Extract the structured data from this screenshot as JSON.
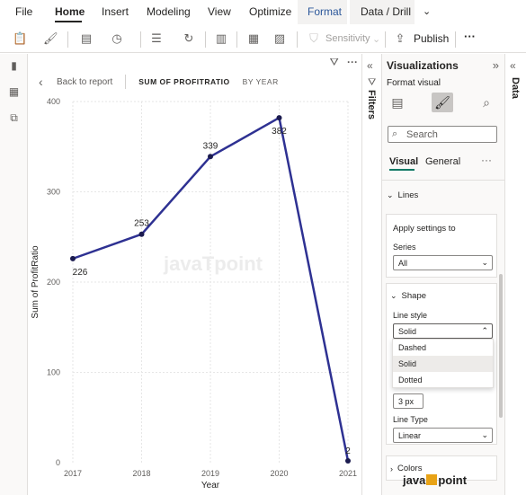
{
  "ribbon": {
    "tabs": [
      {
        "label": "File"
      },
      {
        "label": "Home"
      },
      {
        "label": "Insert"
      },
      {
        "label": "Modeling"
      },
      {
        "label": "View"
      },
      {
        "label": "Optimize"
      },
      {
        "label": "Format"
      },
      {
        "label": "Data / Drill"
      }
    ],
    "active_tab": "Home",
    "expand_icon": "chevron-down-icon"
  },
  "toolbar": {
    "sensitivity_label": "Sensitivity",
    "publish_label": "Publish",
    "more_label": "···"
  },
  "leftrail": {
    "items": [
      {
        "icon": "report-view-icon"
      },
      {
        "icon": "table-view-icon"
      },
      {
        "icon": "model-view-icon"
      }
    ]
  },
  "canvas": {
    "back_label": "Back to report",
    "breadcrumb_title": "SUM OF PROFITRATIO",
    "breadcrumb_by": "BY YEAR"
  },
  "chart_data": {
    "type": "line",
    "x": [
      "2017",
      "2018",
      "2019",
      "2020",
      "2021"
    ],
    "series": [
      {
        "values": [
          226,
          253,
          339,
          382,
          2
        ]
      }
    ],
    "data_labels": [
      "226",
      "253",
      "339",
      "382",
      "2"
    ],
    "xlabel": "Year",
    "ylabel": "Sum of ProfitRatio",
    "ylim": [
      0,
      400
    ],
    "yticks": [
      "0",
      "100",
      "200",
      "300",
      "400"
    ],
    "line_color": "#2e3192",
    "grid": true,
    "watermark": "javaTpoint"
  },
  "filters_pane": {
    "label": "Filters"
  },
  "visualizations": {
    "title": "Visualizations",
    "format_label": "Format visual",
    "search_placeholder": "Search",
    "subtabs": [
      "Visual",
      "General"
    ],
    "active_subtab": "Visual",
    "lines_section": "Lines",
    "apply_settings_title": "Apply settings to",
    "series_label": "Series",
    "series_value": "All",
    "shape_section": "Shape",
    "line_style_label": "Line style",
    "line_style_value": "Solid",
    "line_style_options": [
      "Dashed",
      "Solid",
      "Dotted"
    ],
    "line_style_selected": "Solid",
    "width_value": "3 px",
    "line_type_label": "Line Type",
    "line_type_value": "Linear",
    "colors_section": "Colors"
  },
  "data_pane": {
    "label": "Data"
  },
  "watermark": {
    "text_left": "java",
    "text_right": "point"
  },
  "colors": {
    "accent": "#117865",
    "line": "#2e3192"
  }
}
